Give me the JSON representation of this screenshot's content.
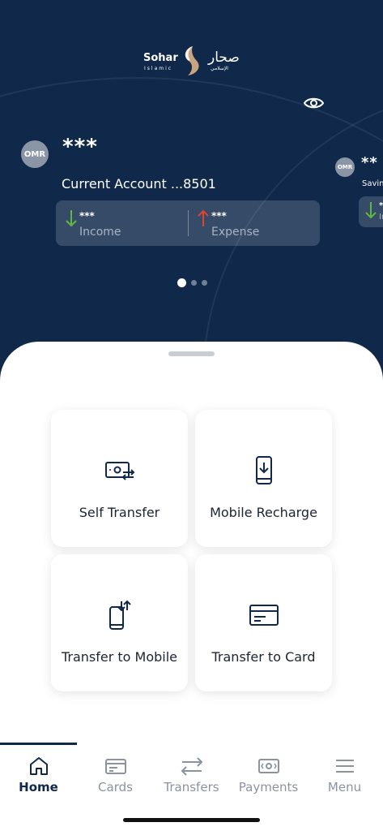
{
  "brand": {
    "name_en": "Sohar",
    "sub_en": "Islamic",
    "name_ar": "صحار",
    "sub_ar": "الإسلامي"
  },
  "accounts": [
    {
      "currency": "OMR",
      "balance": "***",
      "name": "Current Account ...8501",
      "income_value": "***",
      "income_label": "Income",
      "expense_value": "***",
      "expense_label": "Expense"
    },
    {
      "currency": "OMR",
      "balance": "**",
      "name": "Savin",
      "income_value": "**",
      "income_label": "In"
    }
  ],
  "pagination": {
    "total": 3,
    "active": 1
  },
  "actions": [
    {
      "label": "Self Transfer",
      "icon": "money-transfer-icon"
    },
    {
      "label": "Mobile Recharge",
      "icon": "mobile-recharge-icon"
    },
    {
      "label": "Transfer to Mobile",
      "icon": "phone-transfer-icon"
    },
    {
      "label": "Transfer to Card",
      "icon": "card-icon"
    }
  ],
  "nav": [
    {
      "label": "Home",
      "icon": "home-icon",
      "active": true
    },
    {
      "label": "Cards",
      "icon": "card-icon",
      "active": false
    },
    {
      "label": "Transfers",
      "icon": "transfers-icon",
      "active": false
    },
    {
      "label": "Payments",
      "icon": "payments-icon",
      "active": false
    },
    {
      "label": "Menu",
      "icon": "menu-icon",
      "active": false
    }
  ],
  "colors": {
    "primary": "#10294a",
    "income": "#5fb843",
    "expense": "#e0432f",
    "accent_logo": "#c9a47e"
  }
}
